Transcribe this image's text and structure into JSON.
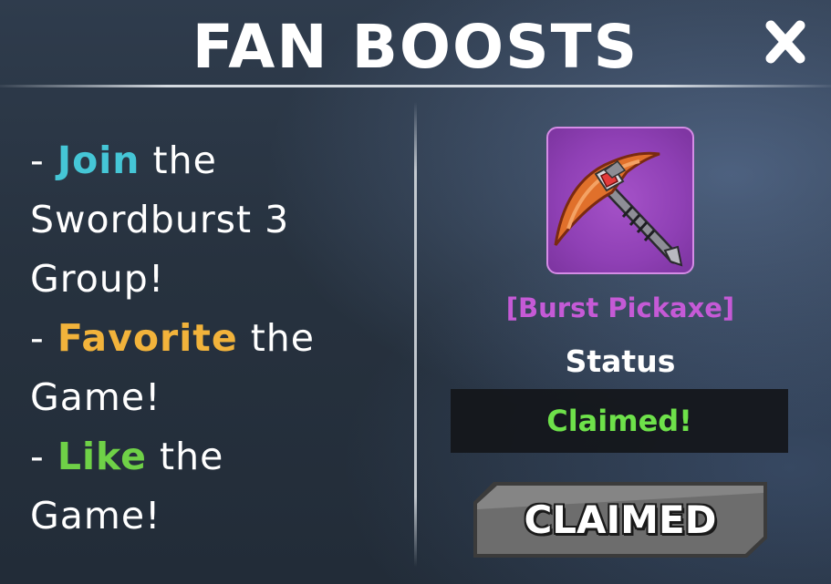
{
  "panel": {
    "title": "FAN BOOSTS"
  },
  "instructions": [
    {
      "prefix": "- ",
      "highlight": "Join",
      "highlight_color": "#45c6d6",
      "rest": " the",
      "cont1": "Swordburst 3",
      "cont2": "Group!"
    },
    {
      "prefix": "- ",
      "highlight": "Favorite",
      "highlight_color": "#f2b33b",
      "rest": " the",
      "cont1": "Game!"
    },
    {
      "prefix": "- ",
      "highlight": "Like",
      "highlight_color": "#6fd147",
      "rest": " the",
      "cont1": "Game!"
    }
  ],
  "reward": {
    "icon": "burst-pickaxe-icon",
    "name": "[Burst Pickaxe]",
    "name_color": "#c55ad6"
  },
  "status": {
    "label": "Status",
    "value": "Claimed!",
    "value_color": "#6ee14a"
  },
  "claim_button": {
    "label": "CLAIMED"
  },
  "colors": {
    "panel_bg": "#27323f",
    "button_gray": "#6b6b6b"
  }
}
